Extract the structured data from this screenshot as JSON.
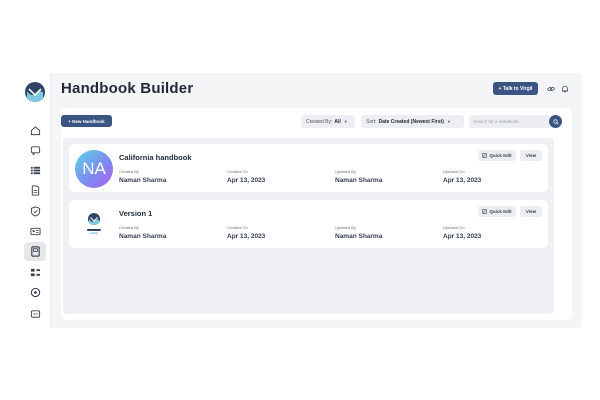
{
  "header": {
    "title": "Handbook Builder",
    "talk_button": "+ Talk to Virgil"
  },
  "toolbar": {
    "new_button": "+ New Handbook",
    "created_by_label": "Created By:",
    "created_by_value": "All",
    "sort_label": "Sort:",
    "sort_value": "Date Created (Newest First)",
    "search_placeholder": "Search for a handbook..."
  },
  "columns": {
    "created_by": "Created By",
    "created_on": "Created On",
    "updated_by": "Updated By",
    "updated_on": "Updated On"
  },
  "actions": {
    "quick_edit": "Quick Edit",
    "view": "View"
  },
  "handbooks": [
    {
      "title": "California handbook",
      "avatar_initials": "NA",
      "created_by": "Naman Sharma",
      "created_on": "Apr 13, 2023",
      "updated_by": "Naman Sharma",
      "updated_on": "Apr 13, 2023"
    },
    {
      "title": "Version 1",
      "avatar_initials": "",
      "created_by": "Naman Sharma",
      "created_on": "Apr 13, 2023",
      "updated_by": "Naman Sharma",
      "updated_on": "Apr 13, 2023"
    }
  ],
  "sidebar": {
    "items": [
      {
        "icon": "home-icon"
      },
      {
        "icon": "chat-icon"
      },
      {
        "icon": "list-icon"
      },
      {
        "icon": "document-icon"
      },
      {
        "icon": "shield-icon"
      },
      {
        "icon": "id-card-icon"
      },
      {
        "icon": "handbook-icon",
        "active": true
      },
      {
        "icon": "tasks-icon"
      },
      {
        "icon": "settings-icon"
      },
      {
        "icon": "message-icon"
      }
    ]
  },
  "colors": {
    "primary": "#3b5583",
    "background": "#f4f5f7",
    "card": "#ffffff"
  }
}
